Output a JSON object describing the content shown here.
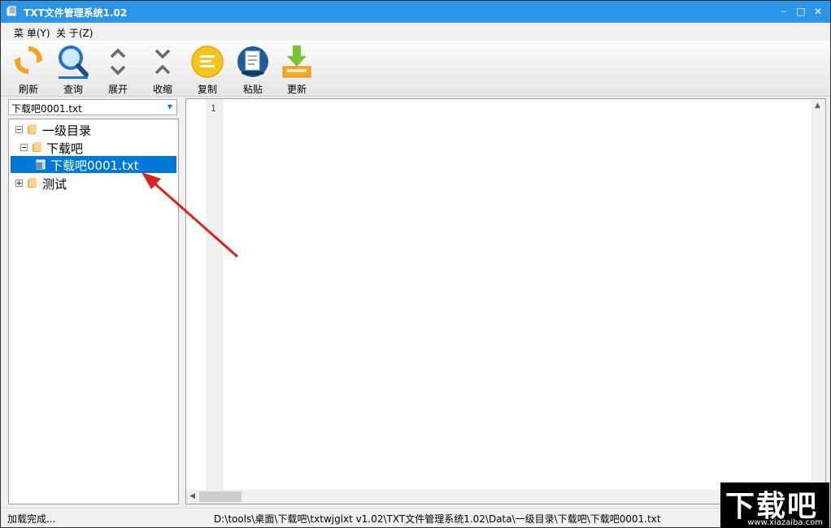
{
  "window": {
    "title": "TXT文件管理系统1.02",
    "controls": {
      "minimize": "–",
      "maximize": "□",
      "close": "✕"
    }
  },
  "menu": [
    {
      "label": "菜 单(Y)"
    },
    {
      "label": "关 于(Z)"
    }
  ],
  "toolbar": [
    {
      "label": "刷新",
      "icon": "refresh-icon"
    },
    {
      "label": "查询",
      "icon": "search-icon"
    },
    {
      "label": "展开",
      "icon": "expand-icon"
    },
    {
      "label": "收缩",
      "icon": "collapse-icon"
    },
    {
      "label": "复制",
      "icon": "copy-icon"
    },
    {
      "label": "粘贴",
      "icon": "paste-icon"
    },
    {
      "label": "更新",
      "icon": "download-icon"
    }
  ],
  "file_combo": {
    "value": "下载吧0001.txt"
  },
  "tree": [
    {
      "label": "一级目录",
      "expanded": true
    },
    {
      "label": "下载吧",
      "expanded": true
    },
    {
      "label": "下载吧0001.txt",
      "selected": true
    },
    {
      "label": "测试",
      "expanded": false
    }
  ],
  "editor": {
    "line_numbers": [
      "1"
    ]
  },
  "status": {
    "left": "加载完成...",
    "path": "D:\\tools\\桌面\\下载吧\\txtwjglxt v1.02\\TXT文件管理系统1.02\\Data\\一级目录\\下载吧\\下载吧0001.txt"
  },
  "watermark": {
    "text": "下载吧",
    "url": "www.xiazaiba.com"
  },
  "colors": {
    "titlebar": "#2b95e8",
    "selection": "#0078d7",
    "annotation_arrow": "#d9241f"
  }
}
